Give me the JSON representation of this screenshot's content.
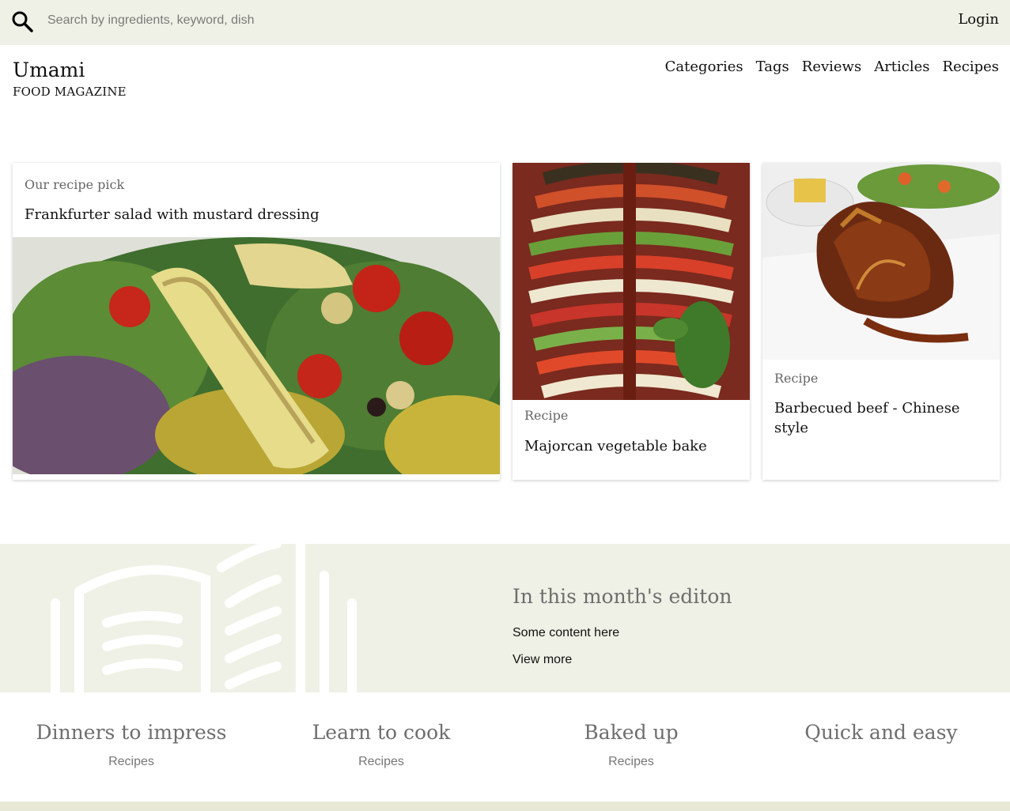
{
  "search": {
    "placeholder": "Search by ingredients, keyword, dish"
  },
  "header": {
    "login": "Login",
    "brand_title": "Umami",
    "brand_subtitle": "FOOD MAGAZINE"
  },
  "nav": [
    "Categories",
    "Tags",
    "Reviews",
    "Articles",
    "Recipes"
  ],
  "featured": {
    "main": {
      "label": "Our recipe pick",
      "title": "Frankfurter salad with mustard dressing"
    },
    "second": {
      "label": "Recipe",
      "title": "Majorcan vegetable bake"
    },
    "third": {
      "label": "Recipe",
      "title": "Barbecued beef - Chinese style"
    }
  },
  "edition": {
    "title": "In this month's editon",
    "text": "Some content here",
    "link": "View more"
  },
  "categories": [
    {
      "title": "Dinners to impress",
      "sub": "Recipes"
    },
    {
      "title": "Learn to cook",
      "sub": "Recipes"
    },
    {
      "title": "Baked up",
      "sub": "Recipes"
    },
    {
      "title": "Quick and easy",
      "sub": ""
    }
  ],
  "colors": {
    "band_bg": "#f0f1e6",
    "heading_gray": "#6e6e6e"
  }
}
